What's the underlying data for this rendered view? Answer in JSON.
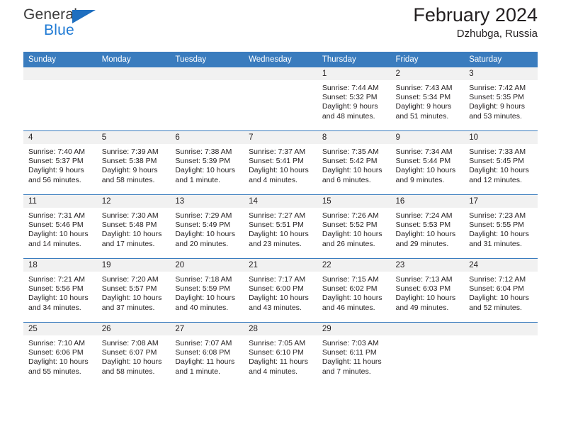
{
  "brand": {
    "line1": "General",
    "line2": "Blue",
    "triangle_color": "#1f6fc0",
    "line2_color": "#1f7ad4"
  },
  "header": {
    "title": "February 2024",
    "location": "Dzhubga, Russia",
    "accent_color": "#3a7cbe"
  },
  "weekdays": [
    "Sunday",
    "Monday",
    "Tuesday",
    "Wednesday",
    "Thursday",
    "Friday",
    "Saturday"
  ],
  "weeks": [
    [
      {
        "day": "",
        "lines": []
      },
      {
        "day": "",
        "lines": []
      },
      {
        "day": "",
        "lines": []
      },
      {
        "day": "",
        "lines": []
      },
      {
        "day": "1",
        "lines": [
          "Sunrise: 7:44 AM",
          "Sunset: 5:32 PM",
          "Daylight: 9 hours",
          "and 48 minutes."
        ]
      },
      {
        "day": "2",
        "lines": [
          "Sunrise: 7:43 AM",
          "Sunset: 5:34 PM",
          "Daylight: 9 hours",
          "and 51 minutes."
        ]
      },
      {
        "day": "3",
        "lines": [
          "Sunrise: 7:42 AM",
          "Sunset: 5:35 PM",
          "Daylight: 9 hours",
          "and 53 minutes."
        ]
      }
    ],
    [
      {
        "day": "4",
        "lines": [
          "Sunrise: 7:40 AM",
          "Sunset: 5:37 PM",
          "Daylight: 9 hours",
          "and 56 minutes."
        ]
      },
      {
        "day": "5",
        "lines": [
          "Sunrise: 7:39 AM",
          "Sunset: 5:38 PM",
          "Daylight: 9 hours",
          "and 58 minutes."
        ]
      },
      {
        "day": "6",
        "lines": [
          "Sunrise: 7:38 AM",
          "Sunset: 5:39 PM",
          "Daylight: 10 hours",
          "and 1 minute."
        ]
      },
      {
        "day": "7",
        "lines": [
          "Sunrise: 7:37 AM",
          "Sunset: 5:41 PM",
          "Daylight: 10 hours",
          "and 4 minutes."
        ]
      },
      {
        "day": "8",
        "lines": [
          "Sunrise: 7:35 AM",
          "Sunset: 5:42 PM",
          "Daylight: 10 hours",
          "and 6 minutes."
        ]
      },
      {
        "day": "9",
        "lines": [
          "Sunrise: 7:34 AM",
          "Sunset: 5:44 PM",
          "Daylight: 10 hours",
          "and 9 minutes."
        ]
      },
      {
        "day": "10",
        "lines": [
          "Sunrise: 7:33 AM",
          "Sunset: 5:45 PM",
          "Daylight: 10 hours",
          "and 12 minutes."
        ]
      }
    ],
    [
      {
        "day": "11",
        "lines": [
          "Sunrise: 7:31 AM",
          "Sunset: 5:46 PM",
          "Daylight: 10 hours",
          "and 14 minutes."
        ]
      },
      {
        "day": "12",
        "lines": [
          "Sunrise: 7:30 AM",
          "Sunset: 5:48 PM",
          "Daylight: 10 hours",
          "and 17 minutes."
        ]
      },
      {
        "day": "13",
        "lines": [
          "Sunrise: 7:29 AM",
          "Sunset: 5:49 PM",
          "Daylight: 10 hours",
          "and 20 minutes."
        ]
      },
      {
        "day": "14",
        "lines": [
          "Sunrise: 7:27 AM",
          "Sunset: 5:51 PM",
          "Daylight: 10 hours",
          "and 23 minutes."
        ]
      },
      {
        "day": "15",
        "lines": [
          "Sunrise: 7:26 AM",
          "Sunset: 5:52 PM",
          "Daylight: 10 hours",
          "and 26 minutes."
        ]
      },
      {
        "day": "16",
        "lines": [
          "Sunrise: 7:24 AM",
          "Sunset: 5:53 PM",
          "Daylight: 10 hours",
          "and 29 minutes."
        ]
      },
      {
        "day": "17",
        "lines": [
          "Sunrise: 7:23 AM",
          "Sunset: 5:55 PM",
          "Daylight: 10 hours",
          "and 31 minutes."
        ]
      }
    ],
    [
      {
        "day": "18",
        "lines": [
          "Sunrise: 7:21 AM",
          "Sunset: 5:56 PM",
          "Daylight: 10 hours",
          "and 34 minutes."
        ]
      },
      {
        "day": "19",
        "lines": [
          "Sunrise: 7:20 AM",
          "Sunset: 5:57 PM",
          "Daylight: 10 hours",
          "and 37 minutes."
        ]
      },
      {
        "day": "20",
        "lines": [
          "Sunrise: 7:18 AM",
          "Sunset: 5:59 PM",
          "Daylight: 10 hours",
          "and 40 minutes."
        ]
      },
      {
        "day": "21",
        "lines": [
          "Sunrise: 7:17 AM",
          "Sunset: 6:00 PM",
          "Daylight: 10 hours",
          "and 43 minutes."
        ]
      },
      {
        "day": "22",
        "lines": [
          "Sunrise: 7:15 AM",
          "Sunset: 6:02 PM",
          "Daylight: 10 hours",
          "and 46 minutes."
        ]
      },
      {
        "day": "23",
        "lines": [
          "Sunrise: 7:13 AM",
          "Sunset: 6:03 PM",
          "Daylight: 10 hours",
          "and 49 minutes."
        ]
      },
      {
        "day": "24",
        "lines": [
          "Sunrise: 7:12 AM",
          "Sunset: 6:04 PM",
          "Daylight: 10 hours",
          "and 52 minutes."
        ]
      }
    ],
    [
      {
        "day": "25",
        "lines": [
          "Sunrise: 7:10 AM",
          "Sunset: 6:06 PM",
          "Daylight: 10 hours",
          "and 55 minutes."
        ]
      },
      {
        "day": "26",
        "lines": [
          "Sunrise: 7:08 AM",
          "Sunset: 6:07 PM",
          "Daylight: 10 hours",
          "and 58 minutes."
        ]
      },
      {
        "day": "27",
        "lines": [
          "Sunrise: 7:07 AM",
          "Sunset: 6:08 PM",
          "Daylight: 11 hours",
          "and 1 minute."
        ]
      },
      {
        "day": "28",
        "lines": [
          "Sunrise: 7:05 AM",
          "Sunset: 6:10 PM",
          "Daylight: 11 hours",
          "and 4 minutes."
        ]
      },
      {
        "day": "29",
        "lines": [
          "Sunrise: 7:03 AM",
          "Sunset: 6:11 PM",
          "Daylight: 11 hours",
          "and 7 minutes."
        ]
      },
      {
        "day": "",
        "lines": []
      },
      {
        "day": "",
        "lines": []
      }
    ]
  ]
}
